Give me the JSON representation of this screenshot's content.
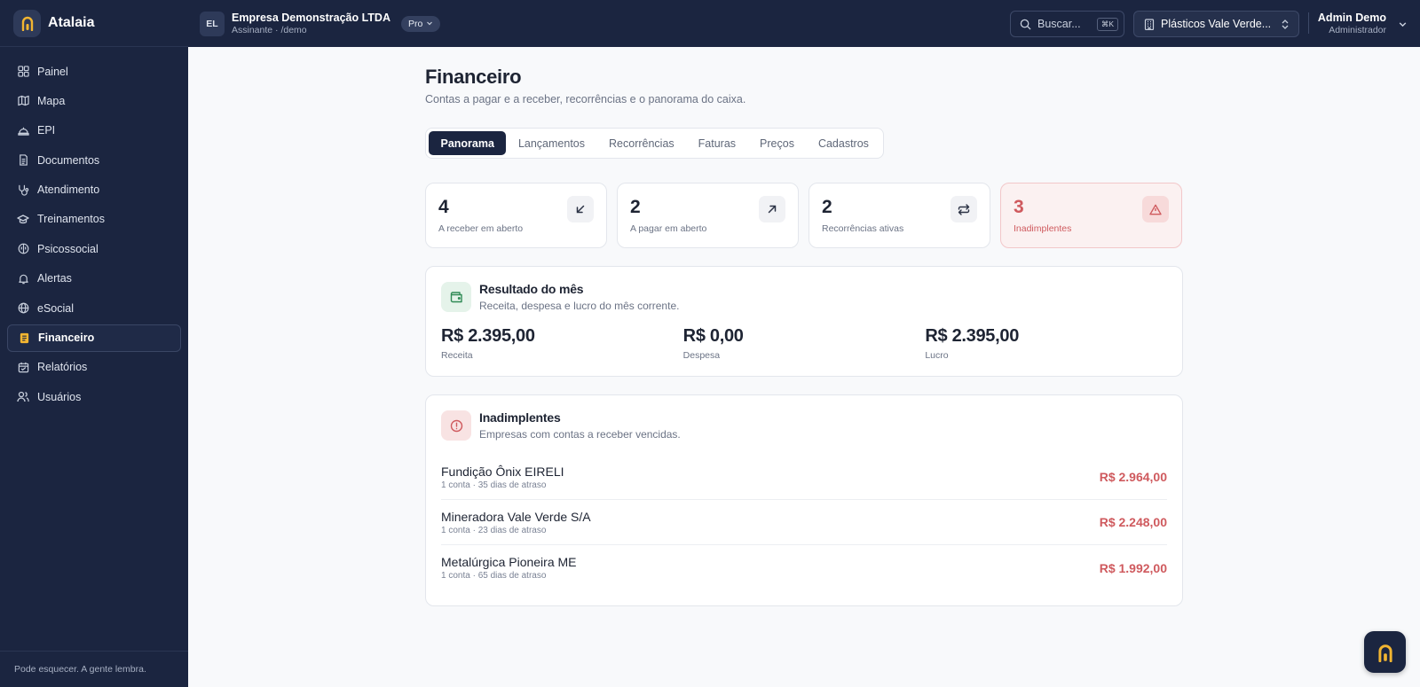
{
  "brand": {
    "name": "Atalaia",
    "accent": "#f2b531"
  },
  "sidebar": {
    "items": [
      {
        "label": "Painel",
        "icon": "grid-icon",
        "active": false
      },
      {
        "label": "Mapa",
        "icon": "map-icon",
        "active": false
      },
      {
        "label": "EPI",
        "icon": "helmet-icon",
        "active": false
      },
      {
        "label": "Documentos",
        "icon": "document-icon",
        "active": false
      },
      {
        "label": "Atendimento",
        "icon": "stethoscope-icon",
        "active": false
      },
      {
        "label": "Treinamentos",
        "icon": "graduation-cap-icon",
        "active": false
      },
      {
        "label": "Psicossocial",
        "icon": "brain-icon",
        "active": false
      },
      {
        "label": "Alertas",
        "icon": "bell-icon",
        "active": false
      },
      {
        "label": "eSocial",
        "icon": "globe-icon",
        "active": false
      },
      {
        "label": "Financeiro",
        "icon": "receipt-icon",
        "active": true
      },
      {
        "label": "Relatórios",
        "icon": "calendar-report-icon",
        "active": false
      },
      {
        "label": "Usuários",
        "icon": "users-icon",
        "active": false
      }
    ],
    "footer": "Pode esquecer. A gente lembra."
  },
  "topbar": {
    "org_initials": "EL",
    "org_name": "Empresa Demonstração LTDA",
    "org_sub": "Assinante · /demo",
    "plan": "Pro",
    "search_placeholder": "Buscar...",
    "search_shortcut": "⌘K",
    "company_selected": "Plásticos Vale Verde...",
    "user_name": "Admin Demo",
    "user_role": "Administrador"
  },
  "page": {
    "title": "Financeiro",
    "subtitle": "Contas a pagar e a receber, recorrências e o panorama do caixa."
  },
  "tabs": [
    {
      "label": "Panorama",
      "active": true
    },
    {
      "label": "Lançamentos",
      "active": false
    },
    {
      "label": "Recorrências",
      "active": false
    },
    {
      "label": "Faturas",
      "active": false
    },
    {
      "label": "Preços",
      "active": false
    },
    {
      "label": "Cadastros",
      "active": false
    }
  ],
  "stats": [
    {
      "value": "4",
      "label": "A receber em aberto",
      "icon": "arrow-down-left-icon"
    },
    {
      "value": "2",
      "label": "A pagar em aberto",
      "icon": "arrow-up-right-icon"
    },
    {
      "value": "2",
      "label": "Recorrências ativas",
      "icon": "repeat-icon"
    },
    {
      "value": "3",
      "label": "Inadimplentes",
      "icon": "warning-triangle-icon"
    }
  ],
  "result": {
    "title": "Resultado do mês",
    "subtitle": "Receita, despesa e lucro do mês corrente.",
    "items": [
      {
        "value": "R$ 2.395,00",
        "label": "Receita"
      },
      {
        "value": "R$ 0,00",
        "label": "Despesa"
      },
      {
        "value": "R$ 2.395,00",
        "label": "Lucro"
      }
    ]
  },
  "debtors": {
    "title": "Inadimplentes",
    "subtitle": "Empresas com contas a receber vencidas.",
    "rows": [
      {
        "name": "Fundição Ônix EIRELI",
        "meta": "1 conta · 35 dias de atraso",
        "amount": "R$ 2.964,00"
      },
      {
        "name": "Mineradora Vale Verde S/A",
        "meta": "1 conta · 23 dias de atraso",
        "amount": "R$ 2.248,00"
      },
      {
        "name": "Metalúrgica Pioneira ME",
        "meta": "1 conta · 65 dias de atraso",
        "amount": "R$ 1.992,00"
      }
    ]
  },
  "colors": {
    "navy": "#1b2540",
    "danger": "#cf5a5e",
    "success": "#2f8a55"
  }
}
